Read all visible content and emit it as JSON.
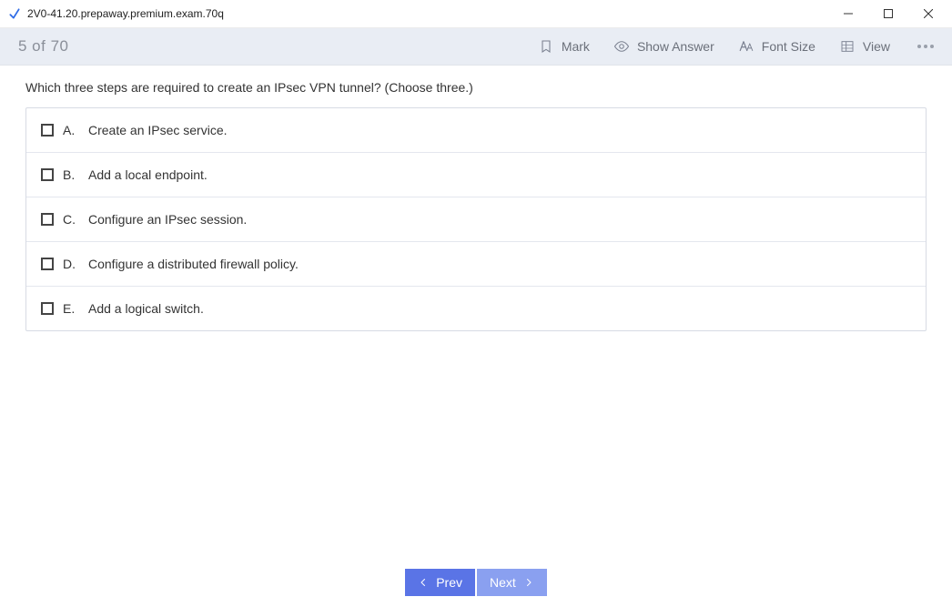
{
  "window": {
    "title": "2V0-41.20.prepaway.premium.exam.70q"
  },
  "toolbar": {
    "progress": "5 of 70",
    "mark_label": "Mark",
    "show_answer_label": "Show Answer",
    "font_size_label": "Font Size",
    "view_label": "View"
  },
  "question": {
    "text": "Which three steps are required to create an IPsec VPN tunnel? (Choose three.)"
  },
  "options": [
    {
      "letter": "A.",
      "text": "Create an IPsec service."
    },
    {
      "letter": "B.",
      "text": "Add a local endpoint."
    },
    {
      "letter": "C.",
      "text": "Configure an IPsec session."
    },
    {
      "letter": "D.",
      "text": "Configure a distributed firewall policy."
    },
    {
      "letter": "E.",
      "text": "Add a logical switch."
    }
  ],
  "nav": {
    "prev_label": "Prev",
    "next_label": "Next"
  }
}
